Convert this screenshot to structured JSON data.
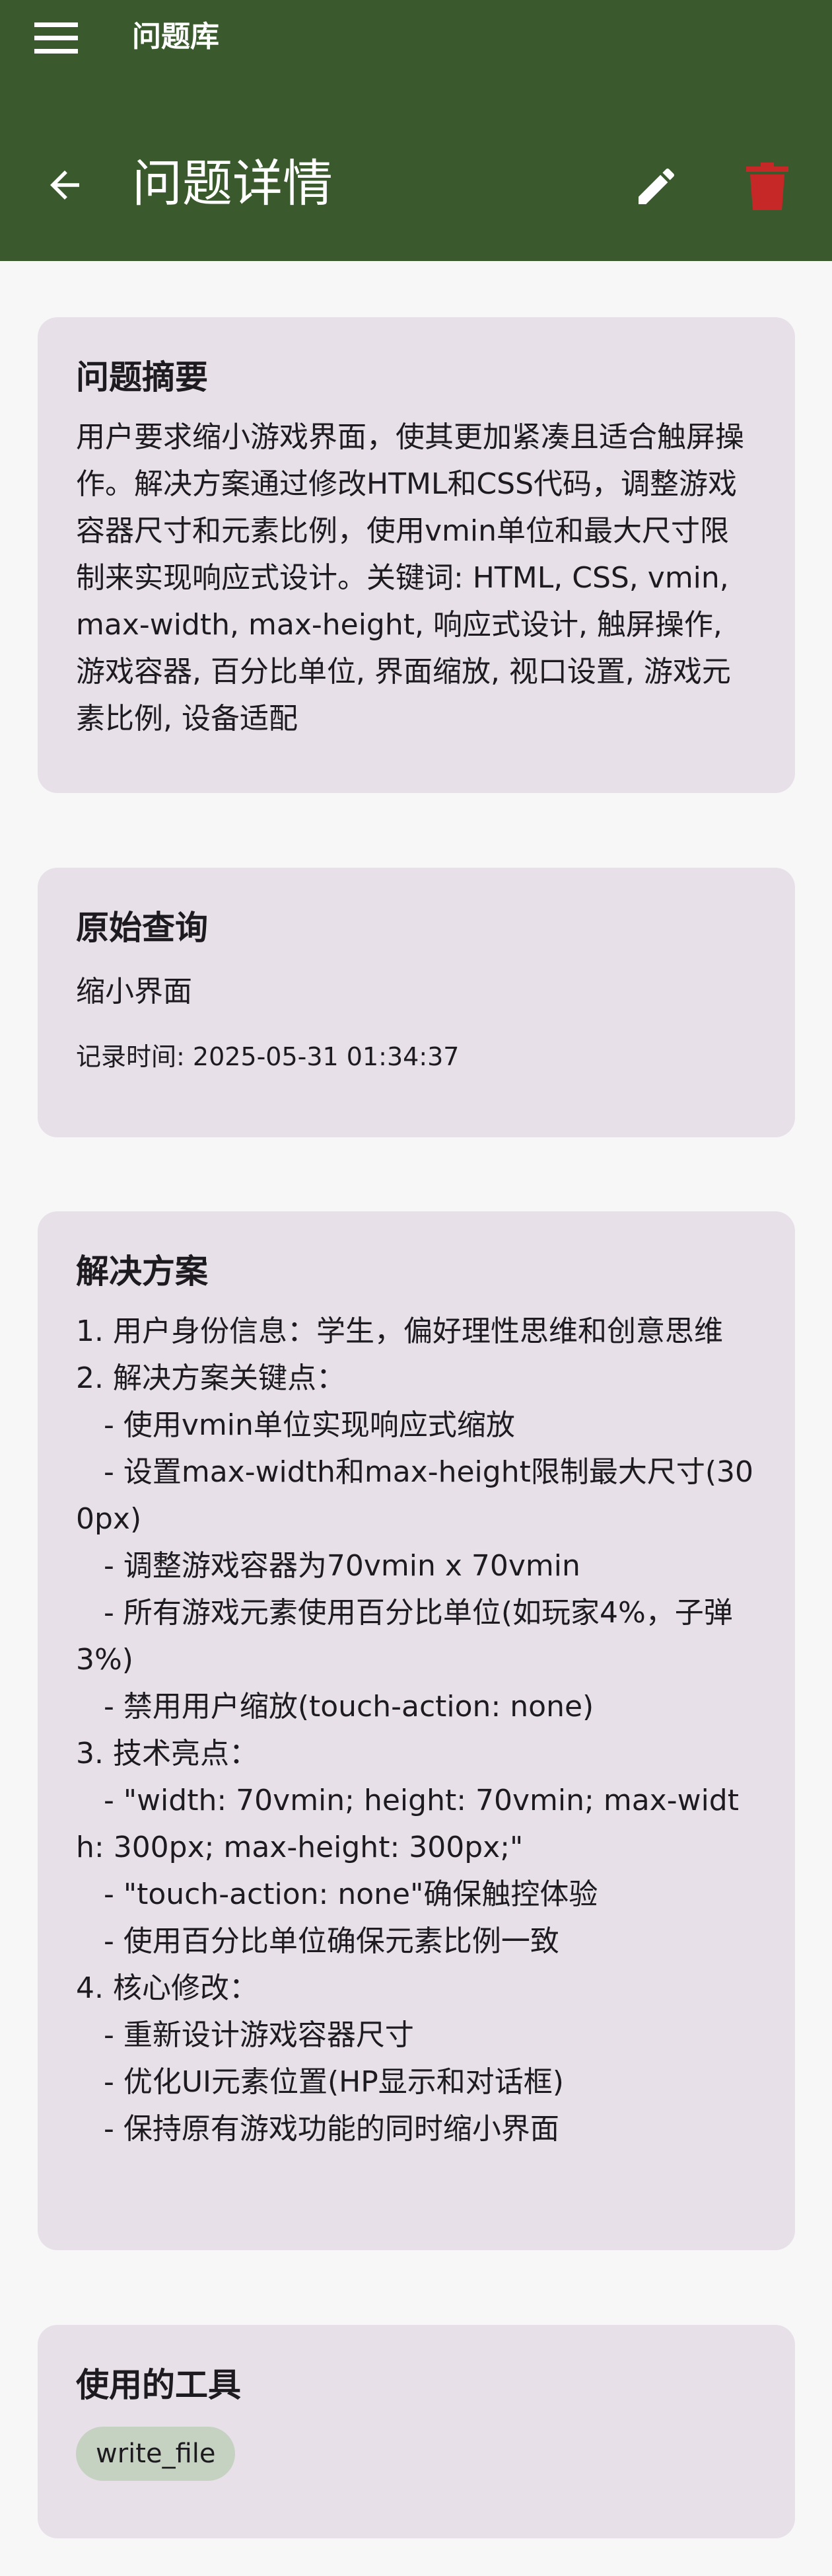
{
  "appbar": {
    "app_title": "问题库",
    "page_title": "问题详情",
    "menu_icon": "menu-icon",
    "back_icon": "arrow-back-icon",
    "edit_icon": "pencil-icon",
    "delete_icon": "trash-icon",
    "colors": {
      "background": "#3a5a2d",
      "delete": "#c62828",
      "text": "#ffffff"
    }
  },
  "summary": {
    "title": "问题摘要",
    "body": "用户要求缩小游戏界面，使其更加紧凑且适合触屏操作。解决方案通过修改HTML和CSS代码，调整游戏容器尺寸和元素比例，使用vmin单位和最大尺寸限制来实现响应式设计。关键词: HTML, CSS, vmin, max-width, max-height, 响应式设计, 触屏操作, 游戏容器, 百分比单位, 界面缩放, 视口设置, 游戏元素比例, 设备适配"
  },
  "original": {
    "title": "原始查询",
    "query": "缩小界面",
    "time_label": "记录时间: ",
    "time_value": "2025-05-31 01:34:37"
  },
  "solution": {
    "title": "解决方案",
    "body": "1. 用户身份信息：学生，偏好理性思维和创意思维\n2. 解决方案关键点：\n   - 使用vmin单位实现响应式缩放\n   - 设置max-width和max-height限制最大尺寸(300px)\n   - 调整游戏容器为70vmin x 70vmin\n   - 所有游戏元素使用百分比单位(如玩家4%，子弹3%)\n   - 禁用用户缩放(touch-action: none)\n3. 技术亮点：\n   - \"width: 70vmin; height: 70vmin; max-width: 300px; max-height: 300px;\"\n   - \"touch-action: none\"确保触控体验\n   - 使用百分比单位确保元素比例一致\n4. 核心修改：\n   - 重新设计游戏容器尺寸\n   - 优化UI元素位置(HP显示和对话框)\n   - 保持原有游戏功能的同时缩小界面"
  },
  "tools": {
    "title": "使用的工具",
    "items": [
      "write_file"
    ]
  }
}
